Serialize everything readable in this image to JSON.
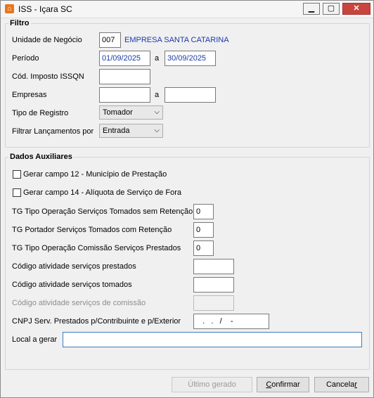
{
  "window": {
    "title": "ISS - Içara SC"
  },
  "filtro": {
    "legend": "Filtro",
    "unidade_label": "Unidade de Negócio",
    "unidade_code": "007",
    "unidade_name": "EMPRESA SANTA CATARINA",
    "periodo_label": "Período",
    "periodo_start": "01/09/2025",
    "periodo_sep": "a",
    "periodo_end": "30/09/2025",
    "cod_imposto_label": "Cód. Imposto ISSQN",
    "cod_imposto_value": "",
    "empresas_label": "Empresas",
    "empresas_start": "",
    "empresas_sep": "a",
    "empresas_end": "",
    "tipo_registro_label": "Tipo de Registro",
    "tipo_registro_value": "Tomador",
    "filtrar_label": "Filtrar Lançamentos por",
    "filtrar_value": "Entrada"
  },
  "aux": {
    "legend": "Dados Auxiliares",
    "campo12_label": "Gerar campo 12 - Município de Prestação",
    "campo14_label": "Gerar campo 14 - Alíquota de Serviço de Fora",
    "tg_tipo_sem_ret_label": "TG Tipo Operação Serviços Tomados sem Retenção",
    "tg_tipo_sem_ret_value": "0",
    "tg_portador_label": "TG Portador Serviços Tomados com Retenção",
    "tg_portador_value": "0",
    "tg_comissao_label": "TG Tipo Operação Comissão Serviços Prestados",
    "tg_comissao_value": "0",
    "cod_prestados_label": "Código atividade serviços prestados",
    "cod_prestados_value": "",
    "cod_tomados_label": "Código atividade serviços tomados",
    "cod_tomados_value": "",
    "cod_comissao_label": "Código atividade serviços de comissão",
    "cod_comissao_value": "",
    "cnpj_label": "CNPJ Serv. Prestados p/Contribuinte e p/Exterior",
    "cnpj_value": "   .   .   /    -",
    "local_label": "Local a gerar",
    "local_value": ""
  },
  "buttons": {
    "ultimo": "Último gerado",
    "confirmar_pre": "",
    "confirmar_u": "C",
    "confirmar_post": "onfirmar",
    "cancelar_pre": "Cancela",
    "cancelar_u": "r",
    "cancelar_post": ""
  },
  "colors": {
    "accent": "#1a3aa8",
    "close": "#c7453d"
  }
}
